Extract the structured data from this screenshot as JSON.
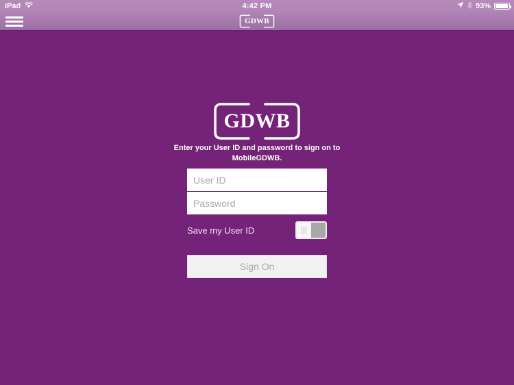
{
  "status_bar": {
    "device": "iPad",
    "wifi_icon": "wifi-icon",
    "time": "4:42 PM",
    "location_icon": "location-arrow-icon",
    "bluetooth_icon": "bluetooth-icon",
    "battery_percent": "93%",
    "battery_icon": "battery-icon"
  },
  "nav_bar": {
    "menu_icon": "hamburger-menu-icon",
    "logo_text": "GDWB"
  },
  "main": {
    "logo_text": "GDWB",
    "instructions": "Enter your User ID and password to sign on to MobileGDWB.",
    "user_id_placeholder": "User ID",
    "user_id_value": "",
    "password_placeholder": "Password",
    "password_value": "",
    "save_label": "Save my User ID",
    "save_toggle_state": "off",
    "sign_on_label": "Sign On"
  },
  "colors": {
    "background_purple": "#752279",
    "nav_bar_top": "#b084b6",
    "nav_bar_bottom": "#9c6fa4",
    "status_bar": "#b185b7",
    "field_white": "#ffffff",
    "placeholder_gray": "#a9a9a9",
    "button_face": "#f2f1f2",
    "button_text": "#a8a8a8",
    "toggle_track": "#a8a8a8"
  }
}
